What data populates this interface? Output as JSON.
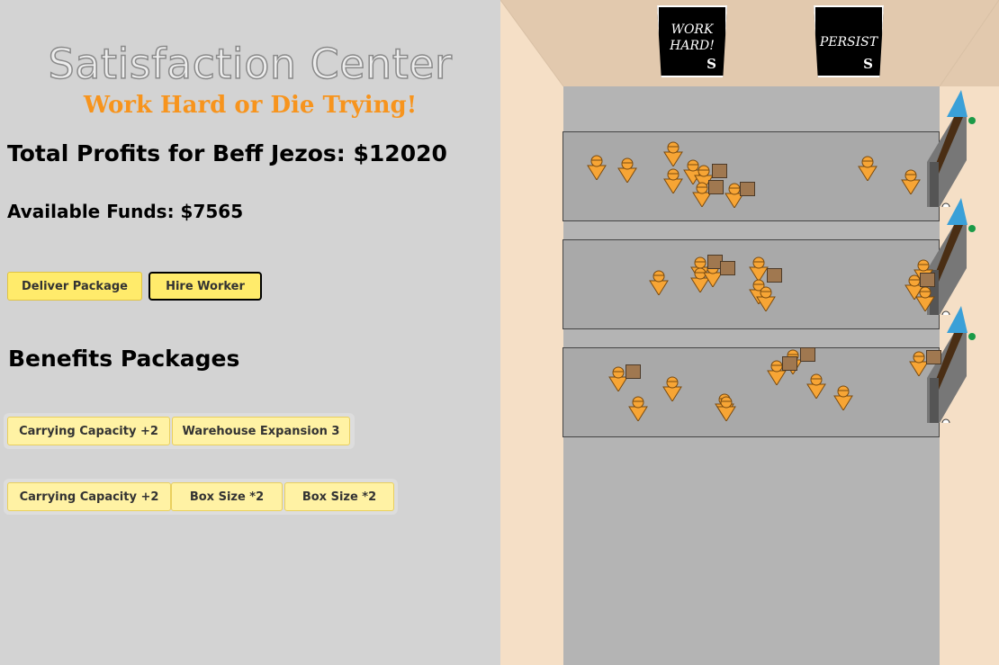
{
  "header": {
    "title": "Satisfaction Center",
    "subtitle": "Work Hard or Die Trying!"
  },
  "stats": {
    "profits": "Total Profits for Beff Jezos: $12020",
    "funds": "Available Funds: $7565"
  },
  "actions": {
    "deliver_label": "Deliver Package",
    "hire_label": "Hire Worker"
  },
  "benefits": {
    "title": "Benefits Packages",
    "row1": [
      "Carrying Capacity +2",
      "Warehouse Expansion 3"
    ],
    "row2": [
      "Carrying Capacity +2",
      "Box Size *2",
      "Box Size *2"
    ]
  },
  "signs": {
    "left": [
      "WORK",
      "HARD!"
    ],
    "right": [
      "PERSIST"
    ],
    "logo": "S"
  },
  "colors": {
    "accent": "#f7941d",
    "button": "#ffeb6b",
    "benefit_button": "#fff2a4",
    "worker": "#f7a535",
    "box": "#a07850",
    "floor": "#b4b4b4",
    "wall": "#f5dfc6"
  }
}
